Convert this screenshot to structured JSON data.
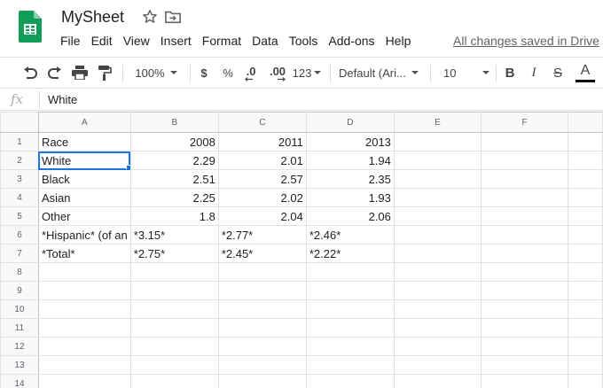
{
  "app": {
    "title": "MySheet",
    "save_status": "All changes saved in Drive"
  },
  "icons": {
    "logo": "google-sheets-logo",
    "star": "star-icon",
    "move": "folder-move-icon"
  },
  "menu": [
    "File",
    "Edit",
    "View",
    "Insert",
    "Format",
    "Data",
    "Tools",
    "Add-ons",
    "Help"
  ],
  "toolbar": {
    "zoom": "100%",
    "currency": "$",
    "percent": "%",
    "decrease_decimal": ".0",
    "increase_decimal": ".00",
    "more_formats": "123",
    "font": "Default (Ari...",
    "font_size": "10",
    "bold": "B",
    "italic": "I",
    "strike": "S",
    "text_color": "A"
  },
  "formula_bar": {
    "fx": "fx",
    "value": "White"
  },
  "sheet": {
    "columns": [
      "A",
      "B",
      "C",
      "D",
      "E",
      "F"
    ],
    "selected_cell": "A2",
    "rows": [
      {
        "n": "1",
        "cells": [
          "Race",
          "2008",
          "2011",
          "2013",
          "",
          ""
        ]
      },
      {
        "n": "2",
        "cells": [
          "White",
          "2.29",
          "2.01",
          "1.94",
          "",
          ""
        ]
      },
      {
        "n": "3",
        "cells": [
          "Black",
          "2.51",
          "2.57",
          "2.35",
          "",
          ""
        ]
      },
      {
        "n": "4",
        "cells": [
          "Asian",
          "2.25",
          "2.02",
          "1.93",
          "",
          ""
        ]
      },
      {
        "n": "5",
        "cells": [
          "Other",
          "1.8",
          "2.04",
          "2.06",
          "",
          ""
        ]
      },
      {
        "n": "6",
        "cells": [
          "*Hispanic* (of an",
          "*3.15*",
          "*2.77*",
          "*2.46*",
          "",
          ""
        ]
      },
      {
        "n": "7",
        "cells": [
          "*Total*",
          "*2.75*",
          "*2.45*",
          "*2.22*",
          "",
          ""
        ]
      },
      {
        "n": "8",
        "cells": [
          "",
          "",
          "",
          "",
          "",
          ""
        ]
      },
      {
        "n": "9",
        "cells": [
          "",
          "",
          "",
          "",
          "",
          ""
        ]
      },
      {
        "n": "10",
        "cells": [
          "",
          "",
          "",
          "",
          "",
          ""
        ]
      },
      {
        "n": "11",
        "cells": [
          "",
          "",
          "",
          "",
          "",
          ""
        ]
      },
      {
        "n": "12",
        "cells": [
          "",
          "",
          "",
          "",
          "",
          ""
        ]
      },
      {
        "n": "13",
        "cells": [
          "",
          "",
          "",
          "",
          "",
          ""
        ]
      },
      {
        "n": "14",
        "cells": [
          "",
          "",
          "",
          "",
          "",
          ""
        ]
      }
    ],
    "cell_align": [
      [
        "txt",
        "num",
        "num",
        "num",
        "txt",
        "txt"
      ],
      [
        "txt",
        "num",
        "num",
        "num",
        "txt",
        "txt"
      ],
      [
        "txt",
        "num",
        "num",
        "num",
        "txt",
        "txt"
      ],
      [
        "txt",
        "num",
        "num",
        "num",
        "txt",
        "txt"
      ],
      [
        "txt",
        "num",
        "num",
        "num",
        "txt",
        "txt"
      ],
      [
        "txt",
        "txt",
        "txt",
        "txt",
        "txt",
        "txt"
      ],
      [
        "txt",
        "txt",
        "txt",
        "txt",
        "txt",
        "txt"
      ]
    ]
  },
  "colors": {
    "accent": "#1a73e8",
    "sheets_green": "#0f9d58",
    "header_bg": "#f8f9fa"
  }
}
